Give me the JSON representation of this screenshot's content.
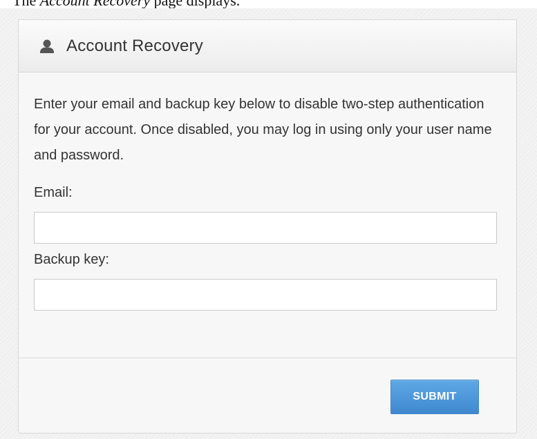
{
  "caption": {
    "prefix": "The ",
    "italic": "Account Recovery",
    "suffix": " page displays."
  },
  "panel": {
    "title": "Account Recovery",
    "icon": "user-icon",
    "description": "Enter your email and backup key below to disable two-step authentication for your account. Once disabled, you may log in using only your user name and password."
  },
  "form": {
    "email_label": "Email:",
    "email_value": "",
    "backup_key_label": "Backup key:",
    "backup_key_value": "",
    "submit_label": "SUBMIT"
  },
  "colors": {
    "accent": "#4a95d9",
    "panel_background": "#f7f7f7",
    "text": "#333333"
  }
}
